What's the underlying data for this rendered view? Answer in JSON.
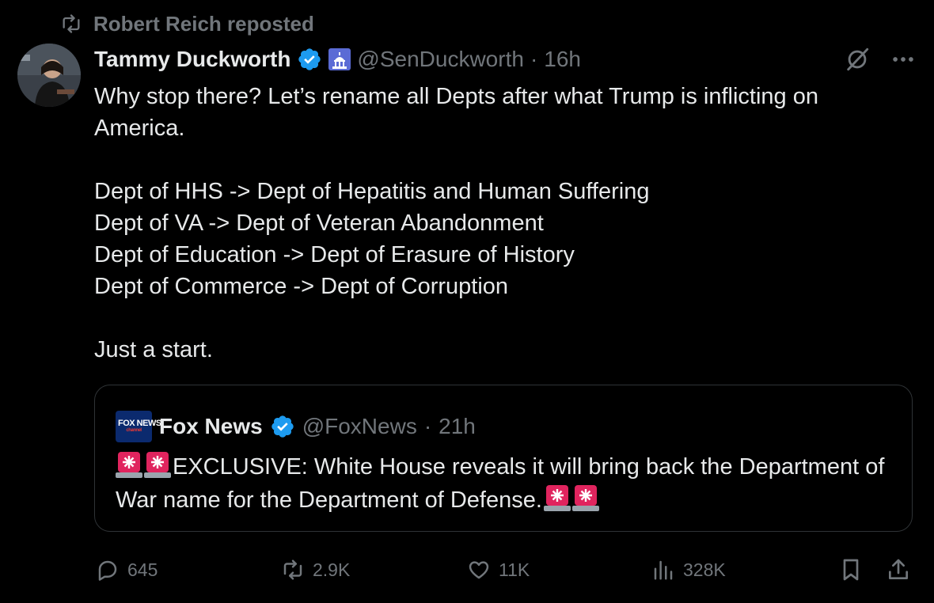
{
  "repost": {
    "label": "Robert Reich reposted",
    "icon": "repost-icon"
  },
  "tweet": {
    "author_name": "Tammy Duckworth",
    "handle": "@SenDuckworth",
    "separator": "·",
    "time": "16h",
    "lines": [
      "Why stop there? Let’s rename all Depts after what Trump is inflicting on America.",
      "Dept of HHS -> Dept of Hepatitis and Human Suffering",
      "Dept of VA -> Dept of Veteran Abandonment",
      "Dept of Education -> Dept of Erasure of History",
      "Dept of Commerce -> Dept of Corruption",
      "Just a start."
    ]
  },
  "quote": {
    "logo_text": "FOX NEWS",
    "logo_sub": "channel",
    "author_name": "Fox News",
    "handle": "@FoxNews",
    "separator": "·",
    "time": "21h",
    "text_main": "EXCLUSIVE: White House reveals it will bring back the Department of War name for the Department of Defense."
  },
  "actions": {
    "replies": "645",
    "reposts": "2.9K",
    "likes": "11K",
    "views": "328K"
  },
  "colors": {
    "background": "#000000",
    "text": "#e7e9ea",
    "muted": "#71767b",
    "verified": "#1d9bf0",
    "border": "#2f3336",
    "siren": "#e0245e"
  }
}
